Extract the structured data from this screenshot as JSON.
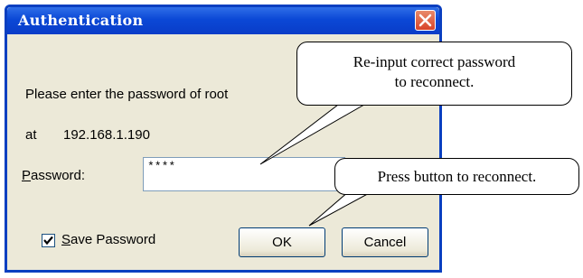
{
  "dialog": {
    "title": "Authentication",
    "prompt_line": "Please enter the password of root",
    "at_label": "at",
    "host": "192.168.1.190",
    "password_label_first": "P",
    "password_label_rest": "assword:",
    "password_value": "****",
    "save_password_first": "S",
    "save_password_rest": "ave Password",
    "save_password_checked": true,
    "ok_label": "OK",
    "cancel_label": "Cancel"
  },
  "callouts": {
    "reinput_line1": "Re-input correct password",
    "reinput_line2": "to reconnect.",
    "press_button": "Press button to reconnect."
  },
  "colors": {
    "titlebar": "#0b48d6",
    "dialog_bg": "#ece9d8",
    "close_button": "#d8442a"
  }
}
